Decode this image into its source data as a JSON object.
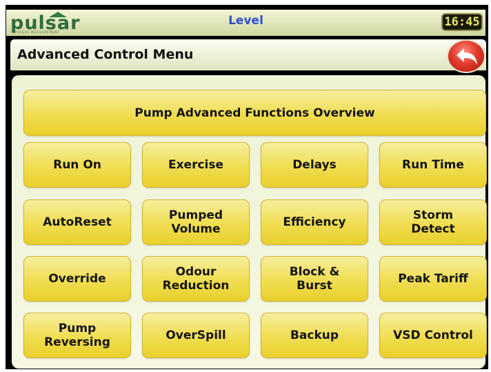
{
  "topbar": {
    "logo_text": "pulsar",
    "logo_sub": "PROCESS MEASUREMENT",
    "title": "Level",
    "clock": "16:45"
  },
  "header": {
    "title": "Advanced Control Menu",
    "back_icon": "back-arrow-icon"
  },
  "menu": {
    "overview_label": "Pump Advanced Functions Overview",
    "buttons": [
      "Run On",
      "Exercise",
      "Delays",
      "Run Time",
      "AutoReset",
      "Pumped\nVolume",
      "Efficiency",
      "Storm\nDetect",
      "Override",
      "Odour\nReduction",
      "Block &\nBurst",
      "Peak Tariff",
      "Pump\nReversing",
      "OverSpill",
      "Backup",
      "VSD Control"
    ]
  },
  "colors": {
    "button_yellow": "#f0dd50",
    "title_blue": "#2e4fd0",
    "back_red": "#e33b2b",
    "panel": "#eef3d4"
  }
}
